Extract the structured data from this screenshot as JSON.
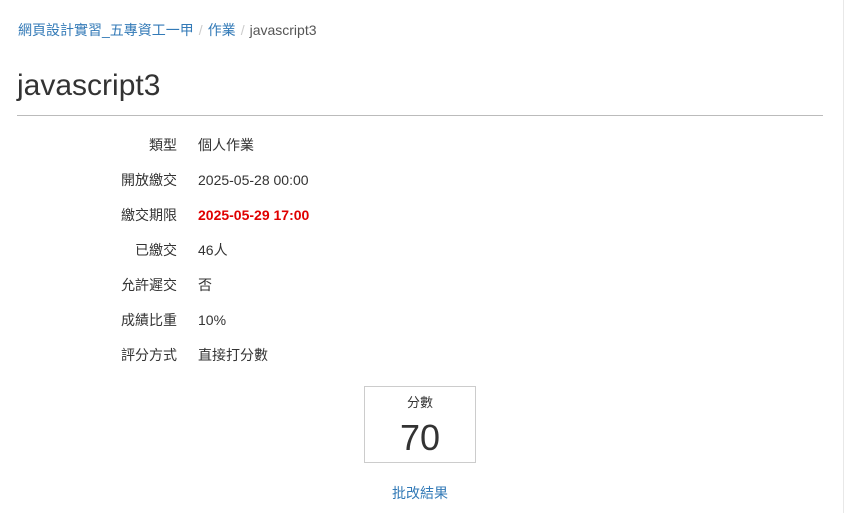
{
  "breadcrumb": {
    "course": "網頁設計實習_五專資工一甲",
    "section": "作業",
    "current": "javascript3",
    "separator": "/"
  },
  "page": {
    "title": "javascript3"
  },
  "info": {
    "rows": [
      {
        "label": "類型",
        "value": "個人作業"
      },
      {
        "label": "開放繳交",
        "value": "2025-05-28 00:00"
      },
      {
        "label": "繳交期限",
        "value": "2025-05-29 17:00"
      },
      {
        "label": "已繳交",
        "value": "46人"
      },
      {
        "label": "允許遲交",
        "value": "否"
      },
      {
        "label": "成績比重",
        "value": "10%"
      },
      {
        "label": "評分方式",
        "value": "直接打分數"
      }
    ]
  },
  "score": {
    "label": "分數",
    "value": "70"
  },
  "grading": {
    "link_label": "批改結果"
  },
  "colors": {
    "link": "#337ab7",
    "deadline": "#e00000",
    "text": "#333333"
  }
}
